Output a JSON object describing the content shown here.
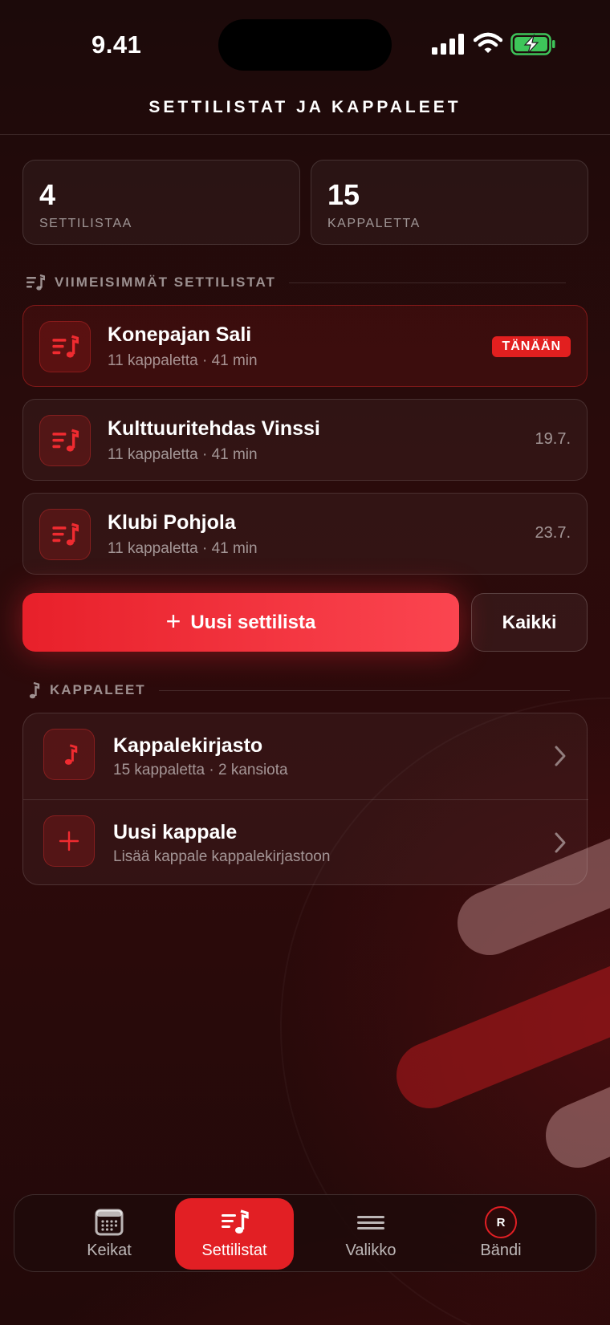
{
  "status_bar": {
    "time": "9.41"
  },
  "header": {
    "title": "SETTILISTAT JA KAPPALEET"
  },
  "stats": [
    {
      "value": "4",
      "label": "SETTILISTAA"
    },
    {
      "value": "15",
      "label": "KAPPALETTA"
    }
  ],
  "recent_section": {
    "title": "VIIMEISIMMÄT SETTILISTAT"
  },
  "setlists": [
    {
      "title": "Konepajan Sali",
      "subtitle": "11 kappaletta · 41 min",
      "badge": "TÄNÄÄN"
    },
    {
      "title": "Kulttuuritehdas Vinssi",
      "subtitle": "11 kappaletta · 41 min",
      "date": "19.7."
    },
    {
      "title": "Klubi Pohjola",
      "subtitle": "11 kappaletta · 41 min",
      "date": "23.7."
    }
  ],
  "actions": {
    "new_setlist": "Uusi settilista",
    "all": "Kaikki"
  },
  "songs_section": {
    "title": "KAPPALEET"
  },
  "songs": [
    {
      "title": "Kappalekirjasto",
      "subtitle": "15 kappaletta · 2 kansiota"
    },
    {
      "title": "Uusi kappale",
      "subtitle": "Lisää kappale kappalekirjastoon"
    }
  ],
  "tabs": [
    {
      "label": "Keikat"
    },
    {
      "label": "Settilistat",
      "active": true
    },
    {
      "label": "Valikko"
    },
    {
      "label": "Bändi",
      "avatar_initial": "R"
    }
  ],
  "colors": {
    "accent": "#e21f24",
    "background": "#2a0b0b"
  }
}
